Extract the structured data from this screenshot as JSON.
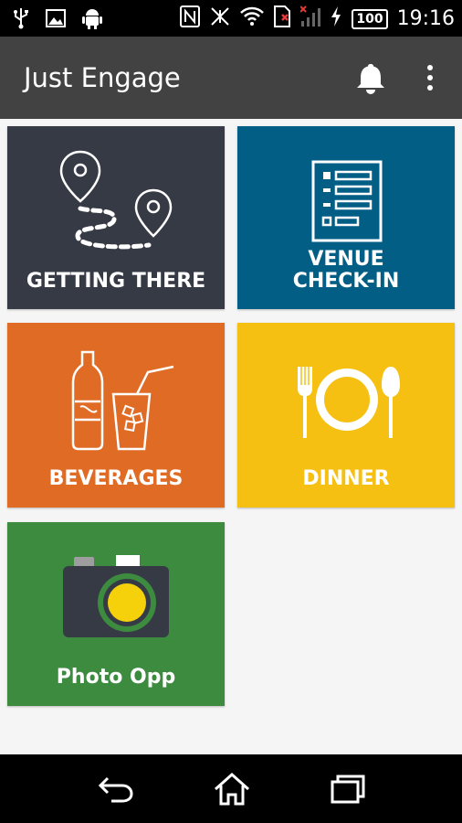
{
  "status_bar": {
    "time": "19:16",
    "battery": "100",
    "icons": [
      "usb-icon",
      "image-icon",
      "android-icon",
      "nfc-icon",
      "vibrate-off-icon",
      "wifi-icon",
      "sim-icon",
      "signal-icon",
      "charging-icon"
    ]
  },
  "app_bar": {
    "title": "Just Engage",
    "actions": [
      "notifications-icon",
      "overflow-menu-icon"
    ]
  },
  "tiles": [
    {
      "line1": "GETTING THERE",
      "line2": "",
      "color": "#363a45",
      "icon": "route-map-icon"
    },
    {
      "line1": "VENUE",
      "line2": "CHECK-IN",
      "color": "#025e84",
      "icon": "checklist-icon"
    },
    {
      "line1": "BEVERAGES",
      "line2": "",
      "color": "#e06b25",
      "icon": "drinks-icon"
    },
    {
      "line1": "DINNER",
      "line2": "",
      "color": "#f5c012",
      "icon": "cutlery-plate-icon"
    },
    {
      "line1": "Photo Opp",
      "line2": "",
      "color": "#3d8b3f",
      "icon": "camera-icon"
    }
  ],
  "nav_bar": {
    "buttons": [
      "back-icon",
      "home-icon",
      "recents-icon"
    ]
  }
}
